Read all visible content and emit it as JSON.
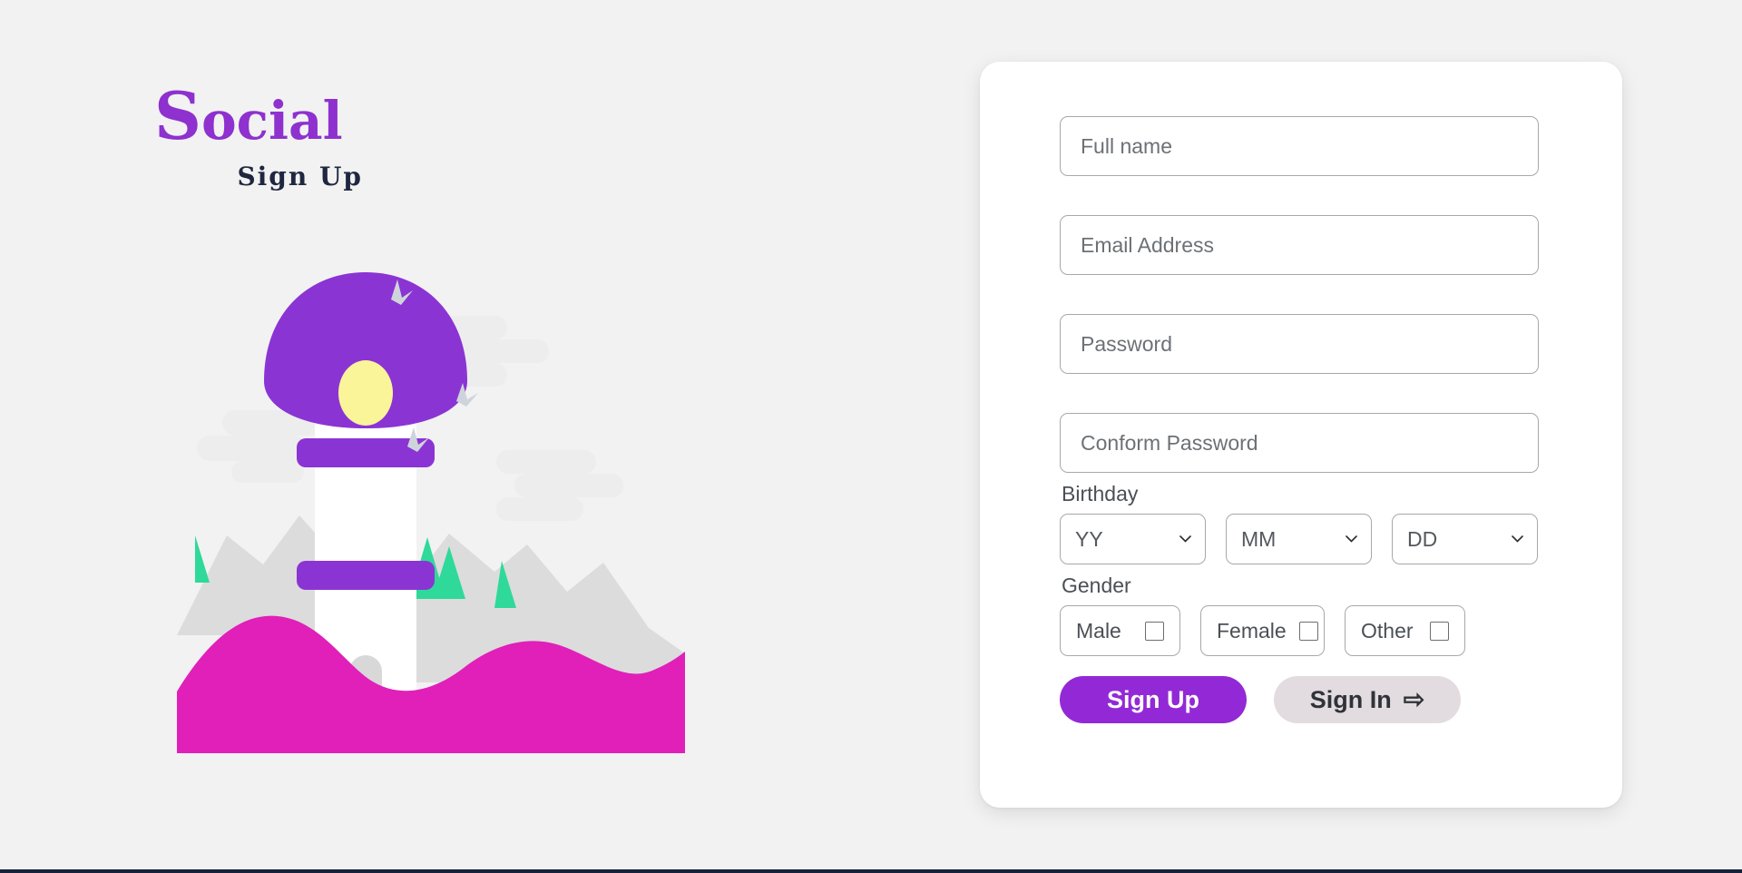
{
  "brand": {
    "name_cap": "S",
    "name_rest": "ocial",
    "subtitle": "Sign Up",
    "accent_color": "#8e31cf",
    "subtitle_color": "#1f2740"
  },
  "illustration": {
    "name": "lighthouse-illustration",
    "dome_color": "#8b34d4",
    "tower_color": "#ffffff",
    "light_color": "#fbf59a",
    "band_color": "#8b34d4",
    "mountain_color": "#dcdcdc",
    "water_color": "#e020b8",
    "tree_color": "#2fd99a",
    "bird_color": "#cfd4dc",
    "cloud_color": "#ededed",
    "door_color": "#d8d8d8"
  },
  "form": {
    "fields": [
      {
        "name": "full-name",
        "placeholder": "Full name",
        "value": ""
      },
      {
        "name": "email-address",
        "placeholder": "Email Address",
        "value": ""
      },
      {
        "name": "password",
        "placeholder": "Password",
        "value": ""
      },
      {
        "name": "conform-password",
        "placeholder": "Conform Password",
        "value": ""
      }
    ],
    "birthday": {
      "label": "Birthday",
      "selects": [
        {
          "name": "year",
          "selected": "YY"
        },
        {
          "name": "month",
          "selected": "MM"
        },
        {
          "name": "day",
          "selected": "DD"
        }
      ]
    },
    "gender": {
      "label": "Gender",
      "options": [
        {
          "name": "male",
          "label": "Male",
          "checked": false
        },
        {
          "name": "female",
          "label": "Female",
          "checked": false
        },
        {
          "name": "other",
          "label": "Other",
          "checked": false
        }
      ]
    },
    "buttons": {
      "primary": {
        "label": "Sign Up",
        "color": "#9329d6"
      },
      "secondary": {
        "label": "Sign In",
        "icon": "arrow-right-icon",
        "glyph": "⇨",
        "color": "#e2dbdf"
      }
    }
  },
  "page": {
    "background": "#f2f2f2",
    "card_background": "#ffffff",
    "bottom_rule_color": "#16213e"
  }
}
